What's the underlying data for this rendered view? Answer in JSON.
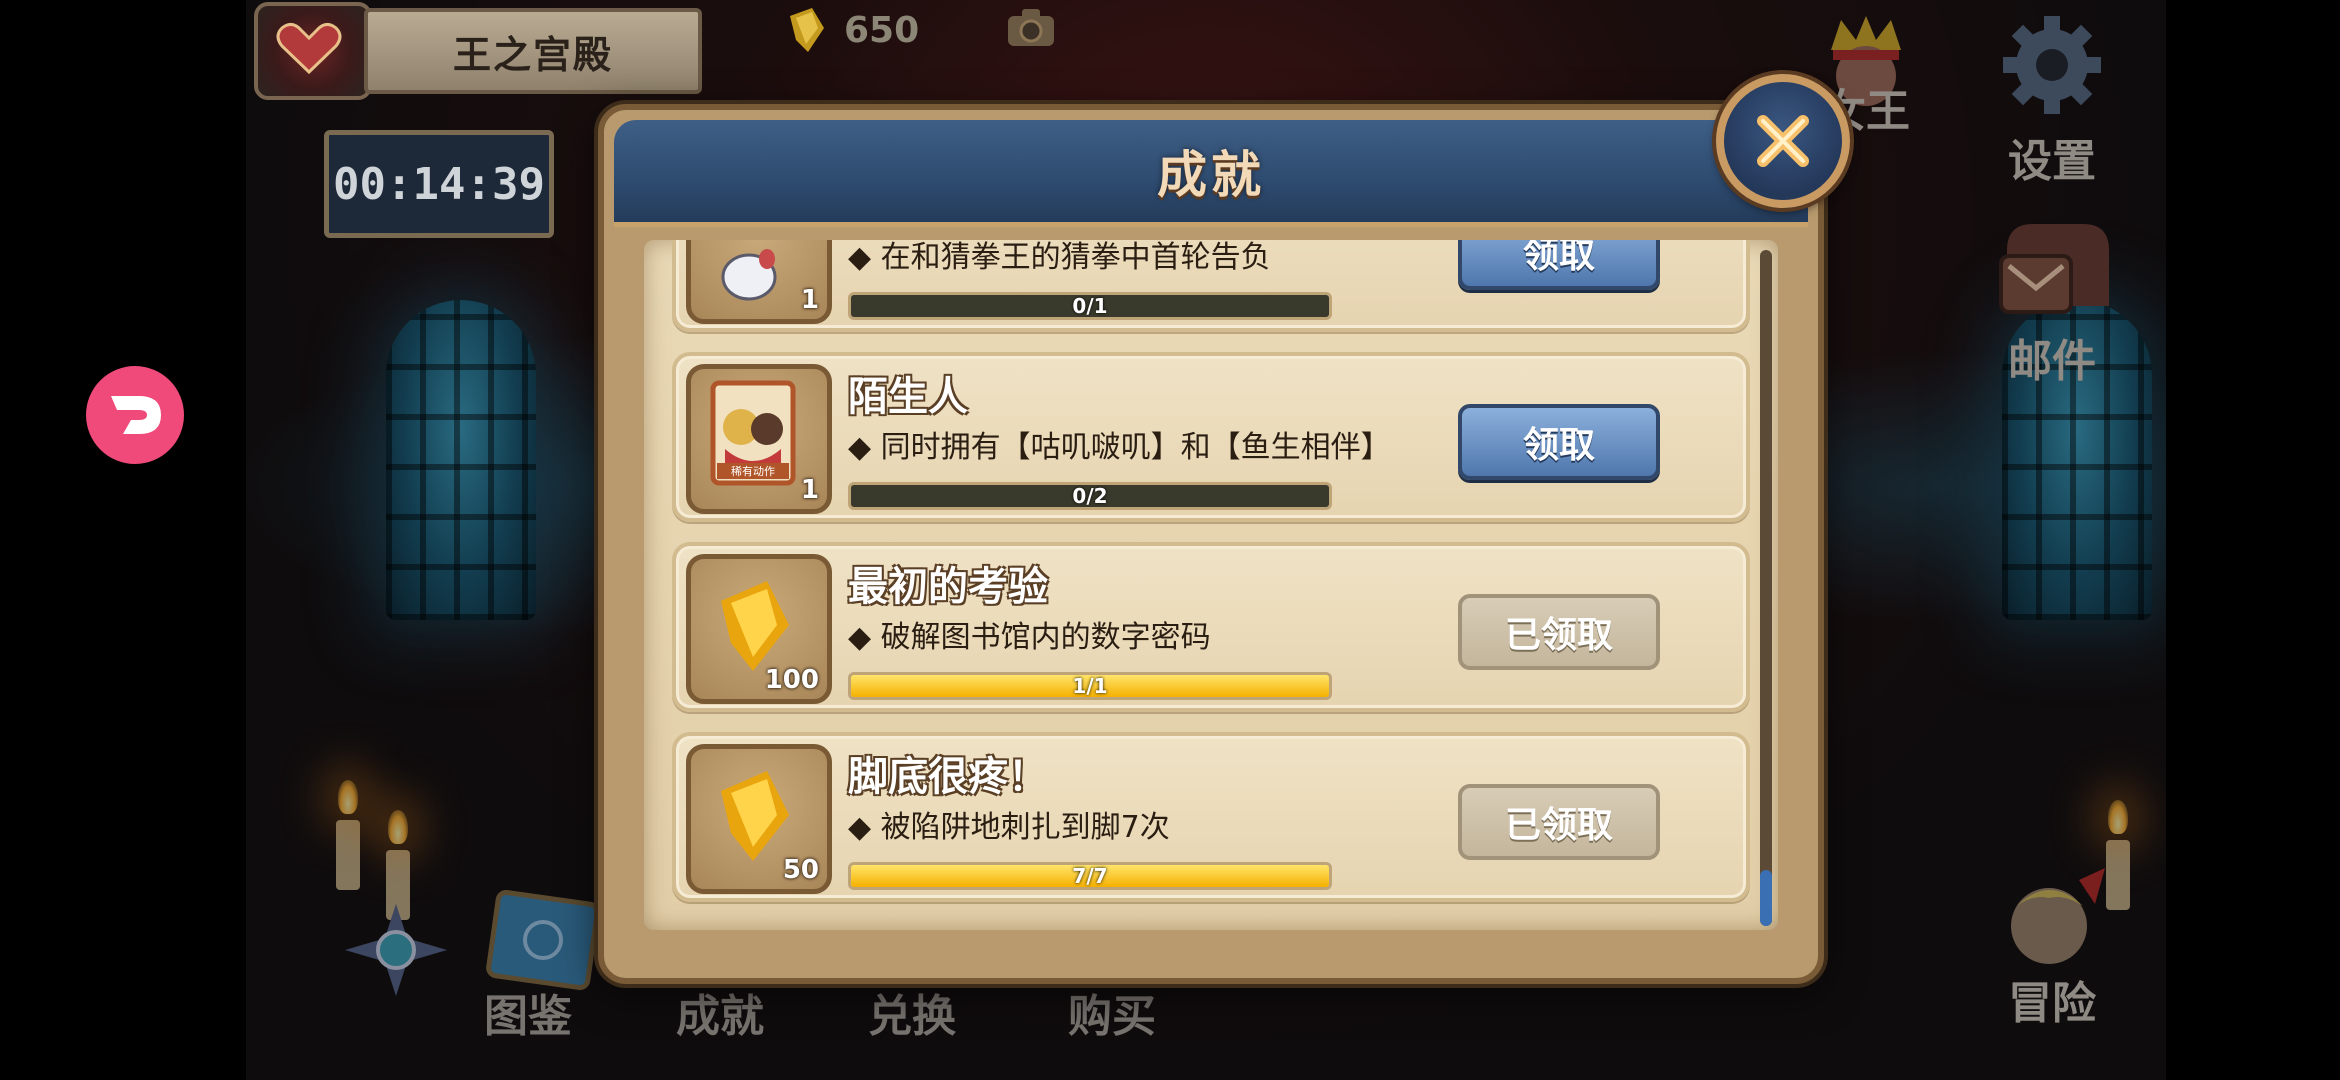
{
  "hud": {
    "location": "王之宫殿",
    "timer": "00:14:39",
    "gems": "650"
  },
  "side_menu": [
    {
      "label": "女王",
      "icon": "queen-portrait-icon"
    },
    {
      "label": "设置",
      "icon": "gear-icon"
    },
    {
      "label": "邮件",
      "icon": "mailbox-icon"
    },
    {
      "label": "冒险",
      "icon": "adventure-portrait-icon"
    }
  ],
  "bottom_nav": [
    {
      "label": "图鉴",
      "icon": "compass-icon"
    },
    {
      "label": "成就",
      "icon": "book-icon"
    },
    {
      "label": "兑换",
      "icon": "exchange-icon"
    },
    {
      "label": "购买",
      "icon": "shop-icon"
    }
  ],
  "dialog": {
    "title": "成就",
    "achievements": [
      {
        "title": "",
        "desc": "◆ 在和猜拳王的猜拳中首轮告负",
        "reward_count": "1",
        "progress_text": "0/1",
        "progress": 0.0,
        "button": "领取",
        "claimed": false,
        "icon": "rabbit-icon"
      },
      {
        "title": "陌生人",
        "desc": "◆ 同时拥有【咕叽啵叽】和【鱼生相伴】",
        "reward_count": "1",
        "reward_badge": "稀有动作",
        "progress_text": "0/2",
        "progress": 0.0,
        "button": "领取",
        "claimed": false,
        "icon": "rare-action-card-icon"
      },
      {
        "title": "最初的考验",
        "desc": "◆ 破解图书馆内的数字密码",
        "reward_count": "100",
        "progress_text": "1/1",
        "progress": 1.0,
        "button": "已领取",
        "claimed": true,
        "icon": "gem-icon"
      },
      {
        "title": "脚底很疼！",
        "desc": "◆ 被陷阱地刺扎到脚7次",
        "reward_count": "50",
        "progress_text": "7/7",
        "progress": 1.0,
        "button": "已领取",
        "claimed": true,
        "icon": "gem-icon"
      }
    ]
  },
  "colors": {
    "claim_button": "#4f77ad",
    "claimed_button": "#c4b69c",
    "progress_fill": "#f5b100",
    "dialog_header": "#2e4b70"
  }
}
